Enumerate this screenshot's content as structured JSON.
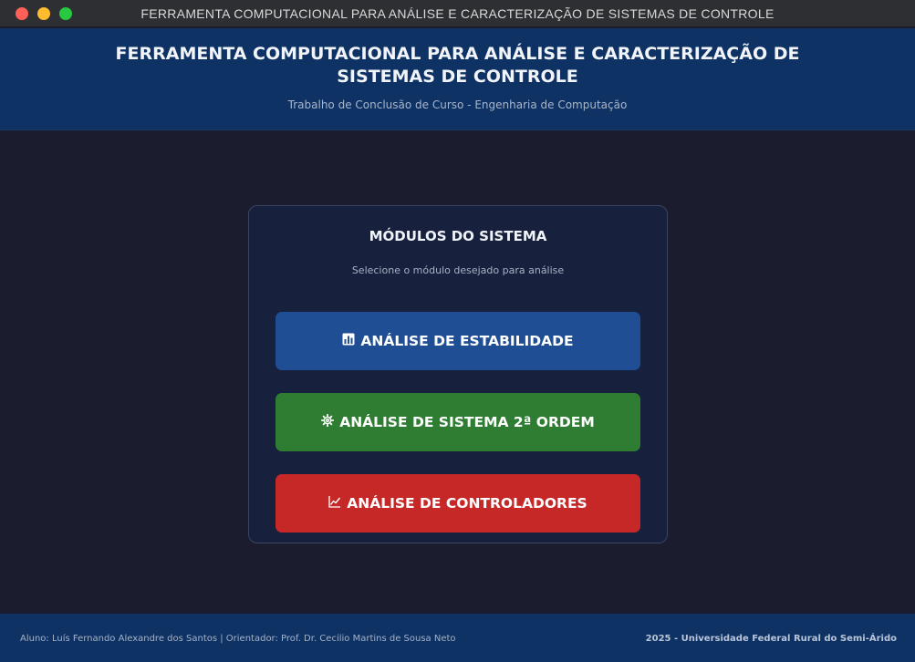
{
  "window": {
    "title": "FERRAMENTA COMPUTACIONAL PARA ANÁLISE E CARACTERIZAÇÃO DE SISTEMAS DE CONTROLE"
  },
  "header": {
    "title": "FERRAMENTA COMPUTACIONAL PARA ANÁLISE E CARACTERIZAÇÃO DE SISTEMAS DE CONTROLE",
    "subtitle": "Trabalho de Conclusão de Curso - Engenharia de Computação"
  },
  "modules": {
    "title": "MÓDULOS DO SISTEMA",
    "subtitle": "Selecione o módulo desejado para análise",
    "buttons": [
      {
        "label": "ANÁLISE DE ESTABILIDADE",
        "icon": "bar-chart-icon",
        "color": "#1f4e94"
      },
      {
        "label": "ANÁLISE DE SISTEMA 2ª ORDEM",
        "icon": "gear-icon",
        "color": "#2e7d32"
      },
      {
        "label": "ANÁLISE DE CONTROLADORES",
        "icon": "line-chart-icon",
        "color": "#c62828"
      }
    ]
  },
  "footer": {
    "left": "Aluno: Luís Fernando Alexandre dos Santos | Orientador: Prof. Dr. Cecilio Martins de Sousa Neto",
    "right": "2025 - Universidade Federal Rural do Semi-Árido"
  },
  "colors": {
    "background": "#1b1c2e",
    "header": "#0f3264",
    "card": "#17213d"
  }
}
